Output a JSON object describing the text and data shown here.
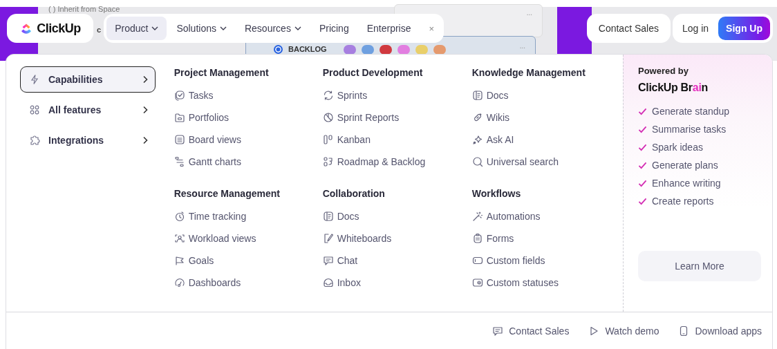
{
  "backdrop": {
    "texts": [
      "( ) Inherit from Space",
      "c",
      "BACKLOG"
    ],
    "dots": [
      {
        "color": "#a77fe0"
      },
      {
        "color": "#6fa0e0"
      },
      {
        "color": "#d0393f"
      },
      {
        "color": "#e27ee0"
      },
      {
        "color": "#e9cf6a"
      },
      {
        "color": "#e59a6e"
      }
    ],
    "more": [
      "...",
      "..."
    ]
  },
  "nav": {
    "logo": "ClickUp",
    "items": [
      {
        "label": "Product",
        "dropdown": true,
        "selected": true
      },
      {
        "label": "Solutions",
        "dropdown": true,
        "selected": false
      },
      {
        "label": "Resources",
        "dropdown": true,
        "selected": false
      },
      {
        "label": "Pricing",
        "dropdown": false,
        "selected": false
      },
      {
        "label": "Enterprise",
        "dropdown": false,
        "selected": false
      }
    ],
    "close": "×",
    "contact_sales": "Contact Sales",
    "login": "Log in",
    "signup": "Sign Up"
  },
  "sidebar": {
    "items": [
      {
        "label": "Capabilities",
        "selected": true
      },
      {
        "label": "All features",
        "selected": false
      },
      {
        "label": "Integrations",
        "selected": false
      }
    ]
  },
  "sections": [
    {
      "title": "Project Management",
      "items": [
        "Tasks",
        "Portfolios",
        "Board views",
        "Gantt charts"
      ]
    },
    {
      "title": "Product Development",
      "items": [
        "Sprints",
        "Sprint Reports",
        "Kanban",
        "Roadmap & Backlog"
      ]
    },
    {
      "title": "Knowledge Management",
      "items": [
        "Docs",
        "Wikis",
        "Ask AI",
        "Universal search"
      ]
    },
    {
      "title": "Resource Management",
      "items": [
        "Time tracking",
        "Workload views",
        "Goals",
        "Dashboards"
      ]
    },
    {
      "title": "Collaboration",
      "items": [
        "Docs",
        "Whiteboards",
        "Chat",
        "Inbox"
      ]
    },
    {
      "title": "Workflows",
      "items": [
        "Automations",
        "Forms",
        "Custom fields",
        "Custom statuses"
      ]
    }
  ],
  "brain": {
    "caption": "Powered by",
    "brand": [
      {
        "text": "ClickUp Br",
        "highlight": false
      },
      {
        "text": "ai",
        "highlight": true
      },
      {
        "text": "n",
        "highlight": false
      }
    ],
    "features": [
      "Generate standup",
      "Summarise tasks",
      "Spark ideas",
      "Generate plans",
      "Enhance writing",
      "Create reports"
    ],
    "button": "Learn More"
  },
  "footer": {
    "links": [
      "Contact Sales",
      "Watch demo",
      "Download apps"
    ]
  }
}
